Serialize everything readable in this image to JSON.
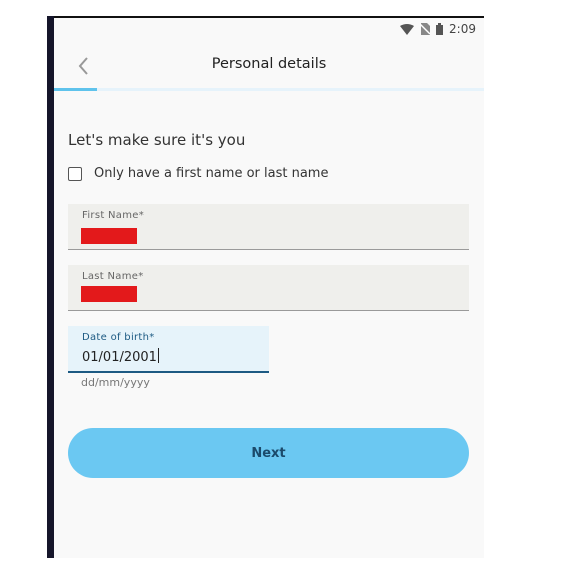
{
  "statusbar": {
    "time": "2:09"
  },
  "header": {
    "title": "Personal details",
    "progress_fraction": 0.1
  },
  "form": {
    "heading": "Let's make sure it's you",
    "single_name_checkbox": {
      "label": "Only have a first name or last name",
      "checked": false
    },
    "first_name": {
      "label": "First Name*",
      "value": ""
    },
    "last_name": {
      "label": "Last Name*",
      "value": ""
    },
    "date_of_birth": {
      "label": "Date of birth*",
      "value": "01/01/2001",
      "helper": "dd/mm/yyyy"
    }
  },
  "actions": {
    "next_label": "Next"
  },
  "colors": {
    "accent": "#6bc8f2",
    "focus": "#1d5a83",
    "redaction": "#e3191b"
  }
}
